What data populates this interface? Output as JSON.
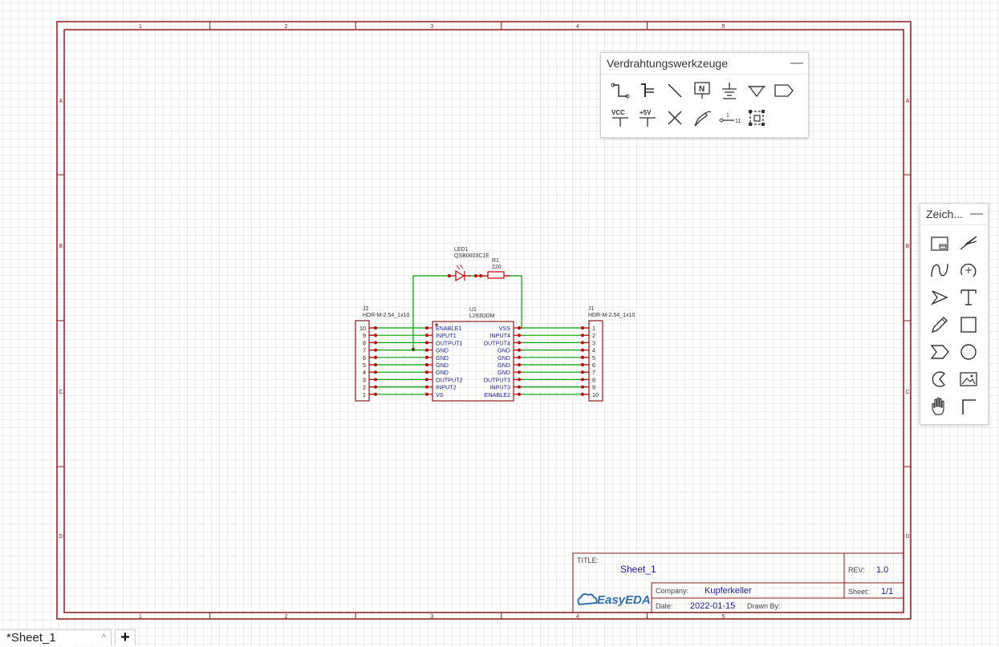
{
  "frame": {
    "column_labels": [
      "1",
      "2",
      "3",
      "4",
      "5"
    ],
    "row_labels": [
      "A",
      "B",
      "C",
      "D"
    ]
  },
  "title_block": {
    "title_label": "TITLE:",
    "title_value": "Sheet_1",
    "rev_label": "REV:",
    "rev_value": "1.0",
    "company_label": "Company:",
    "company_value": "Kupferkeller",
    "sheet_label": "Sheet:",
    "sheet_value": "1/1",
    "date_label": "Date:",
    "date_value": "2022-01-15",
    "drawn_by_label": "Drawn By:",
    "logo_text": "EasyEDA"
  },
  "schematic": {
    "led": {
      "ref": "LED1",
      "value": "QSB0603C1E"
    },
    "resistor": {
      "ref": "R1",
      "value": "220"
    },
    "u1": {
      "ref": "U1",
      "value": "L293DDM",
      "left_pins": [
        "ENABLE1",
        "INPUT1",
        "OUTPUT1",
        "GND",
        "GND",
        "GND",
        "GND",
        "OUTPUT2",
        "INPUT2",
        "VS"
      ],
      "right_pins": [
        "VSS",
        "INPUT4",
        "OUTPUT4",
        "GND",
        "GND",
        "GND",
        "GND",
        "OUTPUT3",
        "INPUT3",
        "ENABLE2"
      ]
    },
    "j2": {
      "ref": "J2",
      "value": "HDR-M-2.54_1x10",
      "pins": [
        "10",
        "9",
        "8",
        "7",
        "6",
        "5",
        "4",
        "3",
        "2",
        "1"
      ]
    },
    "j1": {
      "ref": "J1",
      "value": "HDR-M-2.54_1x10",
      "pins": [
        "1",
        "2",
        "3",
        "4",
        "5",
        "6",
        "7",
        "8",
        "9",
        "10"
      ]
    }
  },
  "wiring_panel": {
    "title": "Verdrahtungswerkzeuge",
    "minimize": "—",
    "tools": [
      "wire-tool",
      "bus-tool",
      "line-tool",
      "net-label-tool",
      "ground-tool",
      "netport-ground-tool",
      "net-port-tool",
      "vcc-tool",
      "plus5v-tool",
      "no-connect-tool",
      "net-flag-tool",
      "pin-tool",
      "group-tool"
    ],
    "vcc_label": "VCC",
    "plus5v_label": "+5V"
  },
  "drawing_panel": {
    "title": "Zeich...",
    "minimize": "—",
    "tools": [
      "image-tool",
      "polyline-tool",
      "bezier-tool",
      "arc-tool",
      "arrow-tool",
      "text-tool",
      "freehand-tool",
      "rectangle-tool",
      "polygon-tool",
      "circle-tool",
      "pie-tool",
      "picture-tool",
      "pan-tool",
      "dimension-tool"
    ]
  },
  "tabs": {
    "sheet_tab_label": "*Sheet_1",
    "close_glyph": "^",
    "add_label": "+"
  }
}
